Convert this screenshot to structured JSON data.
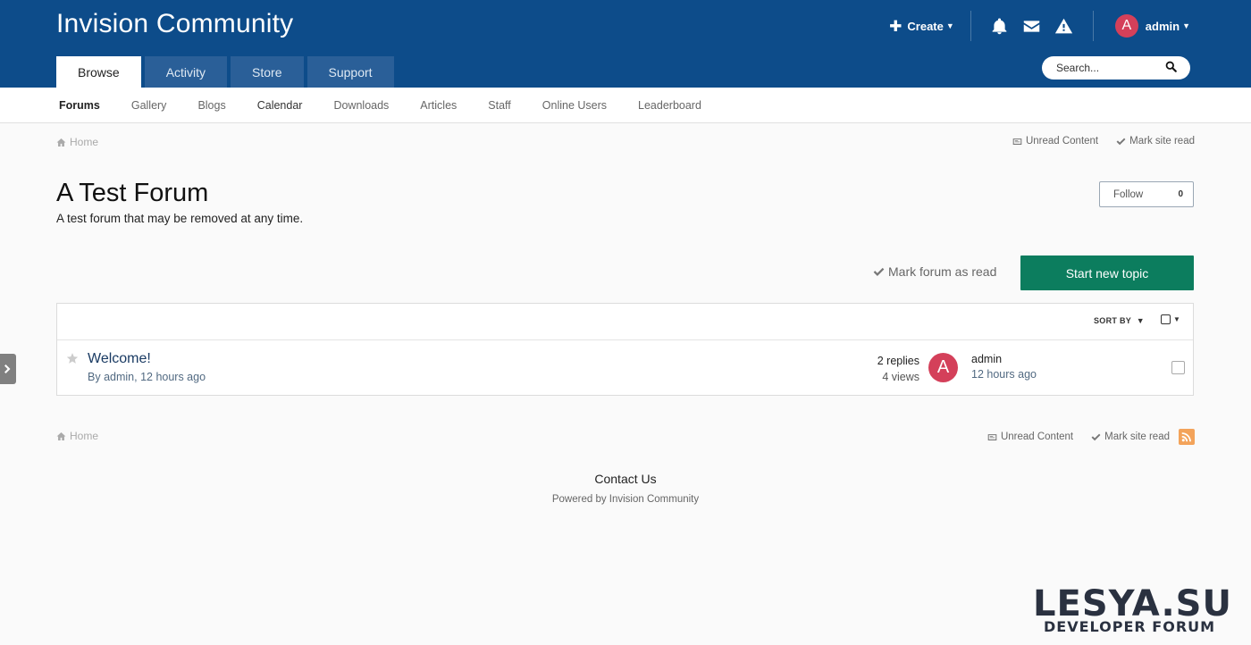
{
  "header": {
    "site_title": "Invision Community",
    "create_label": "Create",
    "username": "admin",
    "avatar_letter": "A",
    "search_placeholder": "Search...",
    "tabs": [
      {
        "label": "Browse",
        "active": true
      },
      {
        "label": "Activity",
        "active": false
      },
      {
        "label": "Store",
        "active": false
      },
      {
        "label": "Support",
        "active": false
      }
    ],
    "icons": [
      "plus-icon",
      "bell-icon",
      "envelope-icon",
      "warning-icon",
      "search-icon"
    ]
  },
  "subnav": {
    "items": [
      "Forums",
      "Gallery",
      "Blogs",
      "Calendar",
      "Downloads",
      "Articles",
      "Staff",
      "Online Users",
      "Leaderboard"
    ]
  },
  "breadcrumb": {
    "home": "Home",
    "unread_content": "Unread Content",
    "mark_site_read": "Mark site read"
  },
  "forum": {
    "title": "A Test Forum",
    "description": "A test forum that may be removed at any time.",
    "follow_label": "Follow",
    "follow_count": "0",
    "mark_forum_read": "Mark forum as read",
    "start_topic": "Start new topic",
    "sort_by": "SORT BY"
  },
  "topics": [
    {
      "title": "Welcome!",
      "meta_prefix": "By ",
      "author": "admin",
      "time": "12 hours ago",
      "replies": "2 replies",
      "views": "4 views",
      "last_poster": "admin",
      "last_poster_avatar": "A",
      "last_time": "12 hours ago"
    }
  ],
  "footer": {
    "contact": "Contact Us",
    "powered": "Powered by Invision Community"
  },
  "watermark": {
    "main": "LESYA.SU",
    "sub": "DEVELOPER FORUM"
  },
  "colors": {
    "header_bg": "#0d4c8a",
    "primary_button": "#0c7d5e",
    "avatar": "#d4405a",
    "rss": "#f3a35a"
  }
}
